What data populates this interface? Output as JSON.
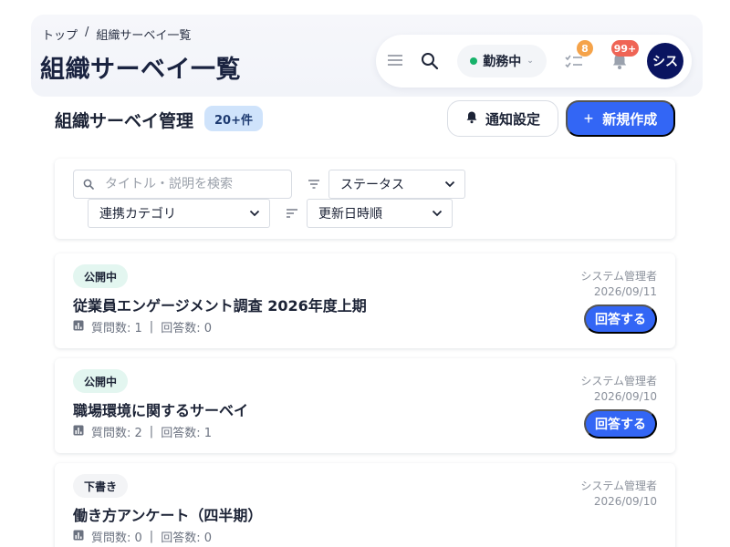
{
  "breadcrumb": {
    "home": "トップ",
    "separator": "/",
    "current": "組織サーベイ一覧"
  },
  "page": {
    "title": "組織サーベイ一覧"
  },
  "toolbar": {
    "status": "勤務中",
    "tasks_badge": "8",
    "notifications_badge": "99+",
    "avatar_initials": "シス"
  },
  "section": {
    "title": "組織サーベイ管理",
    "count": "20+件",
    "notify_button": "通知設定",
    "new_button": "新規作成"
  },
  "filters": {
    "search_placeholder": "タイトル・説明を検索",
    "status_label": "ステータス",
    "category_label": "連携カテゴリ",
    "sort_label": "更新日時順"
  },
  "surveys": [
    {
      "status": "公開中",
      "title": "従業員エンゲージメント調査 2026年度上期",
      "questions": "質問数: 1",
      "answers": "回答数: 0",
      "owner": "システム管理者",
      "date": "2026/09/11",
      "action": "回答する"
    },
    {
      "status": "公開中",
      "title": "職場環境に関するサーベイ",
      "questions": "質問数: 2",
      "answers": "回答数: 1",
      "owner": "システム管理者",
      "date": "2026/09/10",
      "action": "回答する"
    },
    {
      "status": "下書き",
      "title": "働き方アンケート（四半期）",
      "questions": "質問数: 0",
      "answers": "回答数: 0",
      "owner": "システム管理者",
      "date": "2026/09/10"
    }
  ],
  "colors": {
    "accent": "#3366f5",
    "avatar": "#0a1460",
    "working_dot": "#17b26a",
    "tasks_badge": "#f5a34a",
    "notifications_badge": "#ef6455",
    "public_chip": "#e3f6f0"
  },
  "icons": [
    "menu-icon",
    "search-icon",
    "tasks-icon",
    "bell-icon",
    "filter-icon",
    "sort-icon",
    "chevron-down-icon",
    "chart-icon",
    "plus-icon",
    "bell-settings-icon"
  ]
}
